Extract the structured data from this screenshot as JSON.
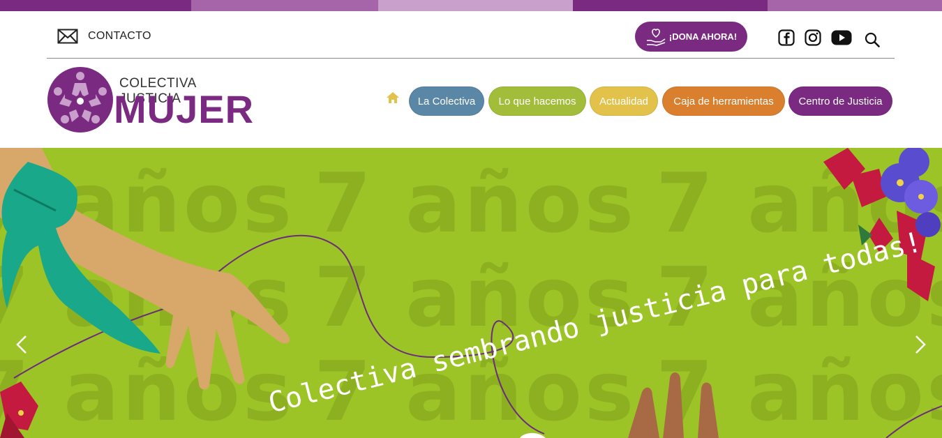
{
  "topbar_colors": [
    "#7b2a82",
    "#a565a8",
    "#c9a0cc",
    "#7b2a82",
    "#a565a8"
  ],
  "header": {
    "contact_icon": "envelope-icon",
    "contact_label": "CONTACTO",
    "donate_icon": "heart-hand-icon",
    "donate_label": "¡DONA AHORA!",
    "social": [
      "facebook-icon",
      "instagram-icon",
      "youtube-icon"
    ],
    "search_icon": "search-icon"
  },
  "logo": {
    "line1": "COLECTIVA JUSTICIA",
    "line2": "MUJER",
    "color": "#7b2a82"
  },
  "nav": {
    "home_icon": "home-icon",
    "items": [
      {
        "label": "La Colectiva",
        "color": "#5b87a6"
      },
      {
        "label": "Lo que hacemos",
        "color": "#a2bd3a"
      },
      {
        "label": "Actualidad",
        "color": "#e2c24a"
      },
      {
        "label": "Caja de herramientas",
        "color": "#d97f2e"
      },
      {
        "label": "Centro de Justicia",
        "color": "#7b2a82"
      }
    ]
  },
  "hero": {
    "background": "#9dc427",
    "watermark": "7 años",
    "slogan": "Colectiva sembrando justicia para todas!",
    "prev_icon": "chevron-left-icon",
    "next_icon": "chevron-right-icon"
  }
}
